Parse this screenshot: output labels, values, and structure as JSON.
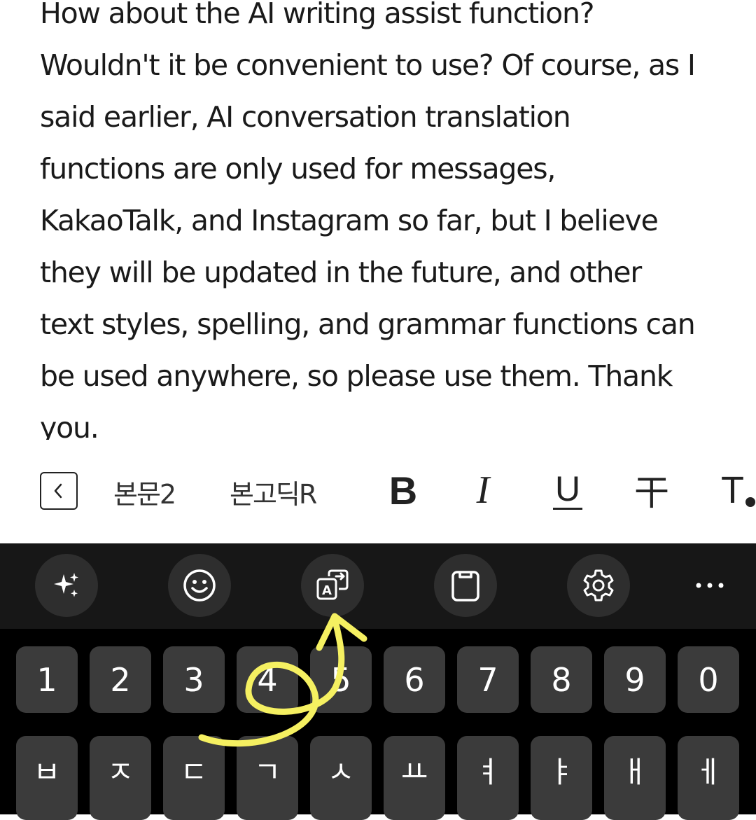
{
  "editor": {
    "lines": [
      "How about the AI writing assist function?",
      "Wouldn't it be convenient to use? Of course, as I",
      "said earlier, AI conversation translation",
      "functions are only used for messages,",
      "KakaoTalk, and Instagram so far, but I believe",
      "they will be updated in the future, and other",
      "text styles, spelling, and grammar functions can",
      "be used anywhere, so please use them. Thank",
      "you."
    ]
  },
  "format_toolbar": {
    "paragraph_style": "본문2",
    "font_name": "본고딕R",
    "bold_label": "B",
    "italic_label": "I",
    "underline_label": "U",
    "strikethrough_label": "干",
    "text_color_label": "T"
  },
  "keyboard_toolbar": {
    "tools": [
      {
        "name": "ai-sparkle-icon"
      },
      {
        "name": "emoji-icon"
      },
      {
        "name": "translate-icon"
      },
      {
        "name": "clipboard-icon"
      },
      {
        "name": "settings-icon"
      },
      {
        "name": "more-icon"
      }
    ]
  },
  "keyboard": {
    "number_row": [
      "1",
      "2",
      "3",
      "4",
      "5",
      "6",
      "7",
      "8",
      "9",
      "0"
    ],
    "korean_row": [
      "ㅂ",
      "ㅈ",
      "ㄷ",
      "ㄱ",
      "ㅅ",
      "ㅛ",
      "ㅕ",
      "ㅑ",
      "ㅐ",
      "ㅔ"
    ]
  },
  "colors": {
    "keyboard_bg": "#000000",
    "toolbar_bg": "#171717",
    "key_bg": "#3b3b3b",
    "annotation": "#f5f061"
  }
}
